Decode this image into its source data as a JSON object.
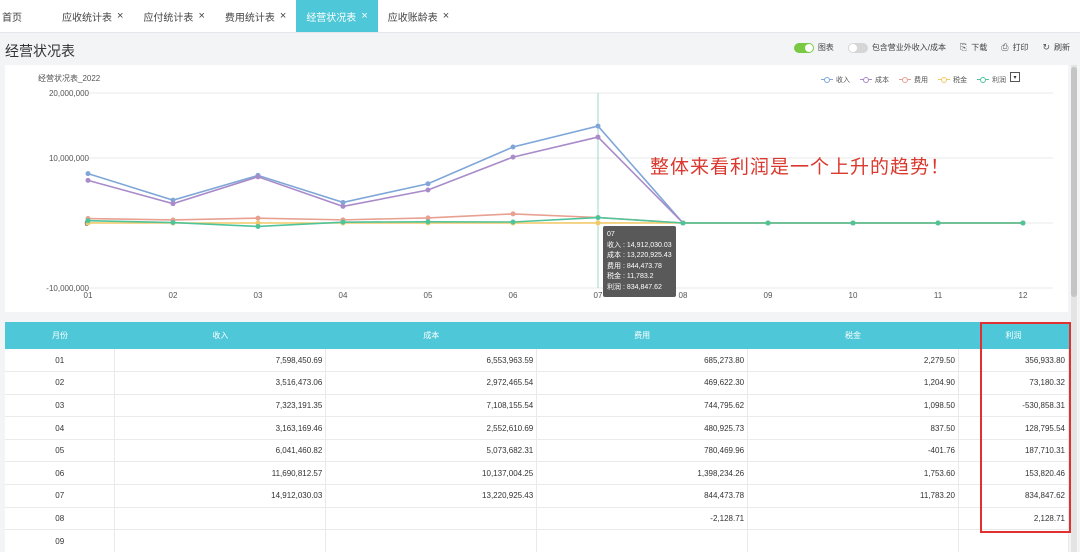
{
  "tabs": [
    {
      "label": "首页",
      "closable": false,
      "active": false
    },
    {
      "label": "应收统计表",
      "closable": true,
      "active": false
    },
    {
      "label": "应付统计表",
      "closable": true,
      "active": false
    },
    {
      "label": "费用统计表",
      "closable": true,
      "active": false
    },
    {
      "label": "经营状况表",
      "closable": true,
      "active": true
    },
    {
      "label": "应收账龄表",
      "closable": true,
      "active": false
    }
  ],
  "close_glyph": "×",
  "page": {
    "title": "经营状况表"
  },
  "toolbar": {
    "chart_toggle_label": "图表",
    "chart_toggle_on": true,
    "include_label": "包含营业外收入/成本",
    "include_on": false,
    "download_label": "下载",
    "print_label": "打印",
    "refresh_label": "刷新"
  },
  "chart_data": {
    "type": "line",
    "title": "经营状况表_2022",
    "categories": [
      "01",
      "02",
      "03",
      "04",
      "05",
      "06",
      "07",
      "08",
      "09",
      "10",
      "11",
      "12"
    ],
    "ylim": [
      -10000000,
      20000000
    ],
    "yticks": [
      "20,000,000",
      "10,000,000",
      "0",
      "-10,000,000"
    ],
    "ytick_values": [
      20000000,
      10000000,
      0,
      -10000000
    ],
    "grid": true,
    "legend_position": "top-right",
    "series": [
      {
        "name": "收入",
        "color": "#7ea6d8",
        "values": [
          7598450.69,
          3516473.06,
          7323191.35,
          3163169.46,
          6041460.82,
          11690812.57,
          14912030.03,
          0,
          0,
          0,
          0,
          0
        ]
      },
      {
        "name": "成本",
        "color": "#a98bc9",
        "values": [
          6553963.59,
          2972465.54,
          7108155.54,
          2552610.69,
          5073682.31,
          10137004.25,
          13220925.43,
          0,
          0,
          0,
          0,
          0
        ]
      },
      {
        "name": "费用",
        "color": "#e8a090",
        "values": [
          685273.8,
          469622.3,
          744795.62,
          480925.73,
          780469.96,
          1398234.26,
          844473.78,
          -2128.71,
          0,
          0,
          0,
          0
        ]
      },
      {
        "name": "税金",
        "color": "#f0c96a",
        "values": [
          2279.5,
          1204.9,
          1098.5,
          837.5,
          -401.76,
          1753.6,
          11783.2,
          0,
          0,
          0,
          0,
          0
        ]
      },
      {
        "name": "利润",
        "color": "#4fc49a",
        "values": [
          356933.8,
          73180.32,
          -530858.31,
          128795.54,
          187710.31,
          153820.46,
          834847.62,
          2128.71,
          0,
          0,
          0,
          0
        ]
      }
    ],
    "tooltip": {
      "month": "07",
      "lines": [
        "收入 : 14,912,030.03",
        "成本 : 13,220,925.43",
        "费用 : 844,473.78",
        "税金 : 11,783.2",
        "利润 : 834,847.62"
      ]
    }
  },
  "annotation": "整体来看利润是一个上升的趋势！",
  "table": {
    "headers": [
      "月份",
      "收入",
      "成本",
      "费用",
      "税金",
      "利润"
    ],
    "rows": [
      [
        "01",
        "7,598,450.69",
        "6,553,963.59",
        "685,273.80",
        "2,279.50",
        "356,933.80"
      ],
      [
        "02",
        "3,516,473.06",
        "2,972,465.54",
        "469,622.30",
        "1,204.90",
        "73,180.32"
      ],
      [
        "03",
        "7,323,191.35",
        "7,108,155.54",
        "744,795.62",
        "1,098.50",
        "-530,858.31"
      ],
      [
        "04",
        "3,163,169.46",
        "2,552,610.69",
        "480,925.73",
        "837.50",
        "128,795.54"
      ],
      [
        "05",
        "6,041,460.82",
        "5,073,682.31",
        "780,469.96",
        "-401.76",
        "187,710.31"
      ],
      [
        "06",
        "11,690,812.57",
        "10,137,004.25",
        "1,398,234.26",
        "1,753.60",
        "153,820.46"
      ],
      [
        "07",
        "14,912,030.03",
        "13,220,925.43",
        "844,473.78",
        "11,783.20",
        "834,847.62"
      ],
      [
        "08",
        "",
        "",
        "-2,128.71",
        "",
        "2,128.71"
      ],
      [
        "09",
        "",
        "",
        "",
        "",
        ""
      ]
    ]
  }
}
